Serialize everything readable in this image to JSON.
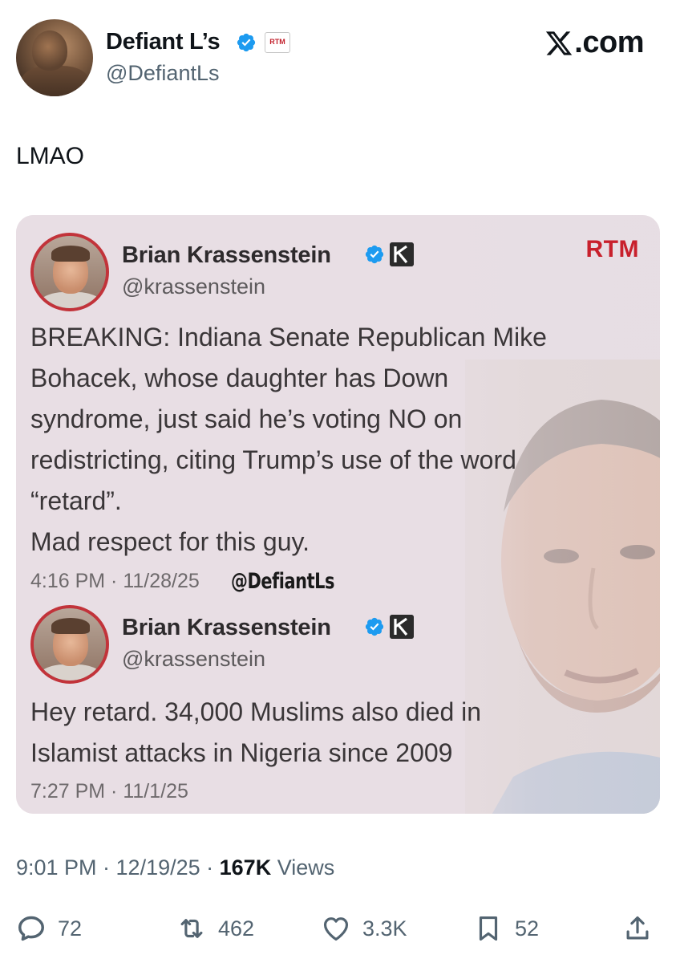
{
  "header": {
    "display_name": "Defiant L’s",
    "handle": "@DefiantLs",
    "rtm_badge": "RTM",
    "site": ".com",
    "site_x": "X"
  },
  "tweet": {
    "text": "LMAO"
  },
  "card": {
    "brand": "RTM",
    "watermark": "@DefiantLs",
    "tweets": [
      {
        "name": "Brian Krassenstein",
        "handle": "@krassenstein",
        "lines": [
          "BREAKING: Indiana Senate Republican Mike",
          "Bohacek, whose daughter has Down",
          "syndrome, just said he’s voting NO on",
          "redistricting, citing Trump’s use of the word",
          "“retard”.",
          "Mad respect for this guy."
        ],
        "timestamp": "4:16 PM · 11/28/25"
      },
      {
        "name": "Brian Krassenstein",
        "handle": "@krassenstein",
        "lines": [
          "Hey retard. 34,000 Muslims also died in",
          "Islamist attacks in Nigeria since 2009"
        ],
        "timestamp": "7:27 PM · 11/1/25"
      }
    ]
  },
  "meta": {
    "time_date": "9:01 PM · 12/19/25 · ",
    "views_count": "167K",
    "views_label": " Views"
  },
  "actions": {
    "replies": "72",
    "reposts": "462",
    "likes": "3.3K",
    "bookmarks": "52"
  },
  "icons": {
    "verified": "verified-badge-icon",
    "reply": "reply-icon",
    "repost": "repost-icon",
    "like": "heart-icon",
    "bookmark": "bookmark-icon",
    "share": "share-icon"
  },
  "colors": {
    "verified_blue": "#1d9bf0",
    "rtm_red": "#c8202c",
    "muted": "#536471",
    "card_bg": "#e6dde3"
  }
}
